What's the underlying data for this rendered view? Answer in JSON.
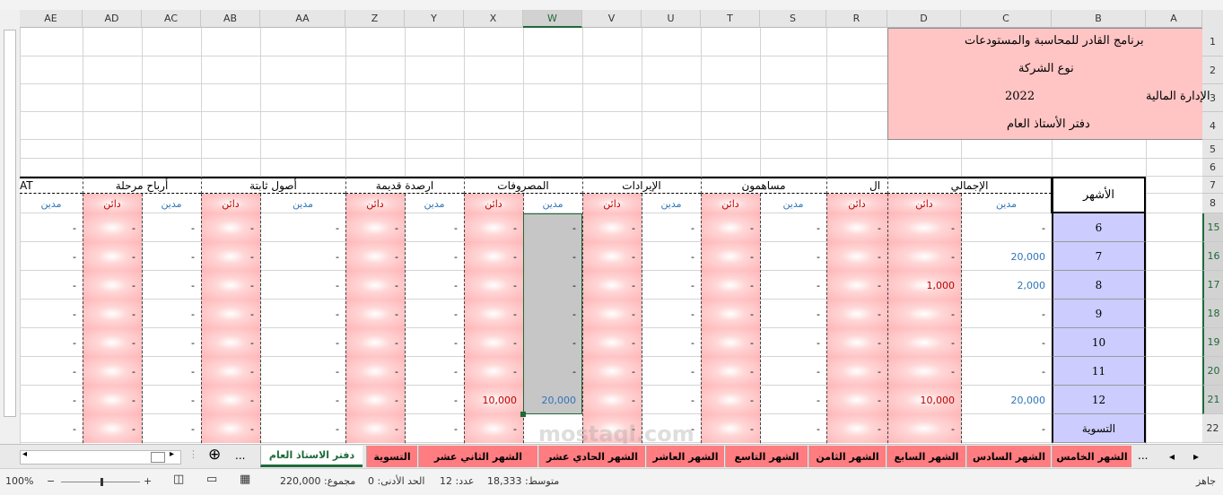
{
  "columns": [
    {
      "letter": "AE"
    },
    {
      "letter": "AD"
    },
    {
      "letter": "AC"
    },
    {
      "letter": "AB"
    },
    {
      "letter": "AA"
    },
    {
      "letter": "Z"
    },
    {
      "letter": "Y"
    },
    {
      "letter": "X"
    },
    {
      "letter": "W"
    },
    {
      "letter": "V"
    },
    {
      "letter": "U"
    },
    {
      "letter": "T"
    },
    {
      "letter": "S"
    },
    {
      "letter": "R"
    },
    {
      "letter": "D"
    },
    {
      "letter": "C"
    },
    {
      "letter": "B"
    },
    {
      "letter": "A"
    }
  ],
  "rows": [
    "1",
    "2",
    "3",
    "4",
    "5",
    "6",
    "7",
    "8",
    "15",
    "16",
    "17",
    "18",
    "19",
    "20",
    "21",
    "22"
  ],
  "header_block": {
    "program": "برنامج القادر للمحاسبة والمستودعات",
    "company_type": "نوع الشركة",
    "year": "2022",
    "department": "الإدارة المالية",
    "ledger": "دفتر الأستاذ العام"
  },
  "groups": {
    "months": "الأشهر",
    "total": "الإجمالي",
    "capital_partial": "ال",
    "shareholders": "مساهمون",
    "revenues": "الإيرادات",
    "expenses": "المصروفات",
    "opening_balances": "ارصدة قديمة",
    "fixed_assets": "أصول ثابتة",
    "carried_profits": "أرباح مرحلة",
    "partial_left": "AT"
  },
  "sub": {
    "debit": "مدين",
    "credit": "دائن"
  },
  "month_rows": [
    {
      "label": "6",
      "D": "-",
      "C": "-",
      "R": "-",
      "S": "-",
      "T": "-",
      "U": "-",
      "V": "-",
      "W": "-",
      "X": "-",
      "Y": "-",
      "Z": "-",
      "AA": "-",
      "AB": "-",
      "AC": "-",
      "AD": "-",
      "AE": "-"
    },
    {
      "label": "7",
      "D": "-",
      "C": "20,000",
      "R": "-",
      "S": "-",
      "T": "-",
      "U": "-",
      "V": "-",
      "W": "-",
      "X": "-",
      "Y": "-",
      "Z": "-",
      "AA": "-",
      "AB": "-",
      "AC": "-",
      "AD": "-",
      "AE": "-"
    },
    {
      "label": "8",
      "D": "1,000",
      "C": "2,000",
      "R": "-",
      "S": "-",
      "T": "-",
      "U": "-",
      "V": "-",
      "W": "-",
      "X": "-",
      "Y": "-",
      "Z": "-",
      "AA": "-",
      "AB": "-",
      "AC": "-",
      "AD": "-",
      "AE": "-"
    },
    {
      "label": "9",
      "D": "-",
      "C": "-",
      "R": "-",
      "S": "-",
      "T": "-",
      "U": "-",
      "V": "-",
      "W": "-",
      "X": "-",
      "Y": "-",
      "Z": "-",
      "AA": "-",
      "AB": "-",
      "AC": "-",
      "AD": "-",
      "AE": "-"
    },
    {
      "label": "10",
      "D": "-",
      "C": "-",
      "R": "-",
      "S": "-",
      "T": "-",
      "U": "-",
      "V": "-",
      "W": "-",
      "X": "-",
      "Y": "-",
      "Z": "-",
      "AA": "-",
      "AB": "-",
      "AC": "-",
      "AD": "-",
      "AE": "-"
    },
    {
      "label": "11",
      "D": "-",
      "C": "-",
      "R": "-",
      "S": "-",
      "T": "-",
      "U": "-",
      "V": "-",
      "W": "-",
      "X": "-",
      "Y": "-",
      "Z": "-",
      "AA": "-",
      "AB": "-",
      "AC": "-",
      "AD": "-",
      "AE": "-"
    },
    {
      "label": "12",
      "D": "10,000",
      "C": "20,000",
      "R": "-",
      "S": "-",
      "T": "-",
      "U": "-",
      "V": "-",
      "W": "20,000",
      "X": "10,000",
      "Y": "-",
      "Z": "-",
      "AA": "-",
      "AB": "-",
      "AC": "-",
      "AD": "-",
      "AE": "-"
    },
    {
      "label": "التسوية",
      "D": "-",
      "C": "-",
      "R": "-",
      "S": "-",
      "T": "-",
      "U": "-",
      "V": "-",
      "W": "",
      "X": "-",
      "Y": "-",
      "Z": "-",
      "AA": "-",
      "AB": "-",
      "AC": "-",
      "AD": "-",
      "AE": "-"
    }
  ],
  "tabs": [
    {
      "label": "الشهر الخامس"
    },
    {
      "label": "الشهر السادس"
    },
    {
      "label": "الشهر السابع"
    },
    {
      "label": "الشهر الثامن"
    },
    {
      "label": "الشهر  التاسع"
    },
    {
      "label": "الشهر العاشر"
    },
    {
      "label": "الشهر الحادي عشر"
    },
    {
      "label": "الشهر  الثاني عشر"
    },
    {
      "label": "التسوية"
    },
    {
      "label": "دفتر الاستاذ العام"
    }
  ],
  "tab_more": "...",
  "status": {
    "ready": "جاهز",
    "average": "متوسط: 18,333",
    "count": "عدد: 12",
    "min": "الحد الأدنى: 0",
    "sum": "مجموع: 220,000",
    "zoom": "100%"
  },
  "watermark": "mostaql.com",
  "colors": {
    "pink": "#ffb6b8",
    "grey": "#c6c6c6",
    "lavender": "#ccccff",
    "tab": "#ff7c80",
    "accent": "#1e6a39",
    "red": "#c00000",
    "blue": "#2e75b6"
  }
}
